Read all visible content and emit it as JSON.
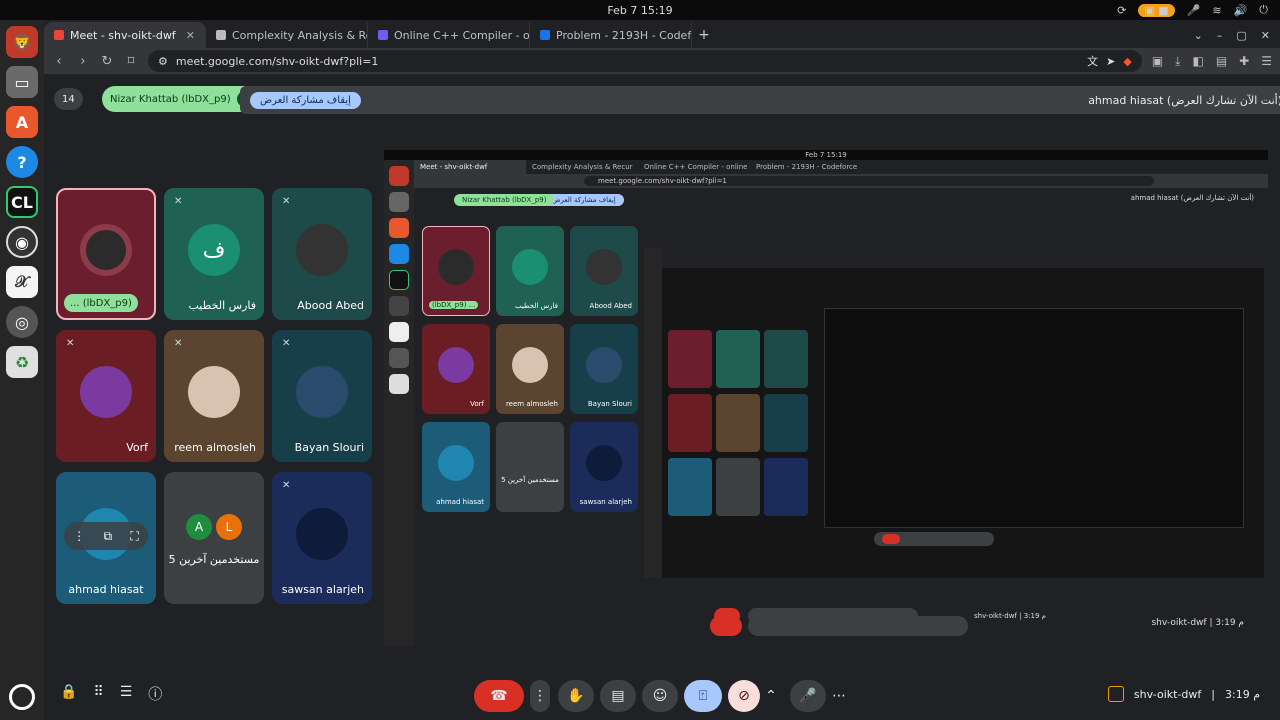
{
  "topbar": {
    "datetime": "Feb 7  15:19"
  },
  "browser": {
    "tabs": [
      {
        "title": "Meet - shv-oikt-dwf",
        "active": true,
        "color": "#e8453c"
      },
      {
        "title": "Complexity Analysis & Recurs",
        "active": false,
        "color": "#bbbbbb"
      },
      {
        "title": "Online C++ Compiler - online",
        "active": false,
        "color": "#6d5df1"
      },
      {
        "title": "Problem - 2193H - Codeforce",
        "active": false,
        "color": "#1a73e8"
      }
    ],
    "url": "meet.google.com/shv-oikt-dwf?pli=1"
  },
  "meet": {
    "participant_count": "14",
    "pinned_name": "Nizar Khattab (lbDX_p9)",
    "stop_sharing": "إيقاف مشاركة العرض",
    "presenting_text": "ahmad hiasat (أنت الآن تشارك العرض)",
    "tiles": [
      {
        "name": "... (lbDX_p9)",
        "color": "#6b1f2e",
        "avatar": "#2b2b2b"
      },
      {
        "name": "فارس الخطيب",
        "color": "#1f6152",
        "avatar": "#1b8f72",
        "letter": "ف"
      },
      {
        "name": "Abood Abed",
        "color": "#1e4a4a",
        "avatar": "#333333"
      },
      {
        "name": "Vorf",
        "color": "#6b1d24",
        "avatar": "#7a3aa0"
      },
      {
        "name": "reem almosleh",
        "color": "#5c4530",
        "avatar": "#d9c2b0"
      },
      {
        "name": "Bayan Slouri",
        "color": "#163f4a",
        "avatar": "#2a4b6b"
      },
      {
        "name": "ahmad hiasat",
        "color": "#1c5c78",
        "avatar": "#1f86b0"
      },
      {
        "name": "5 مستخدمين آخرين",
        "color": "#3c4043",
        "avatar": ""
      },
      {
        "name": "sawsan alarjeh",
        "color": "#1c2c5a",
        "avatar": "#0f1b3a"
      }
    ],
    "others_initials": [
      "A",
      "L"
    ],
    "meeting_code": "shv-oikt-dwf",
    "time": "3:19 م"
  },
  "nested": {
    "datetime": "Feb 7  15:19",
    "tabs": [
      "Meet - shv-oikt-dwf",
      "Complexity Analysis & Recur",
      "Online C++ Compiler - online",
      "Problem - 2193H - Codeforce"
    ],
    "url": "meet.google.com/shv-oikt-dwf?pli=1",
    "names": [
      "(lbDX_p9) ...",
      "فارس الخطيب",
      "Abood Abed",
      "Vorf",
      "reem almosleh",
      "Bayan Slouri",
      "ahmad hiasat",
      "5 مستخدمين آخرين",
      "sawsan alarjeh"
    ],
    "meeting_code": "shv-oikt-dwf",
    "time": "3:19 م"
  }
}
